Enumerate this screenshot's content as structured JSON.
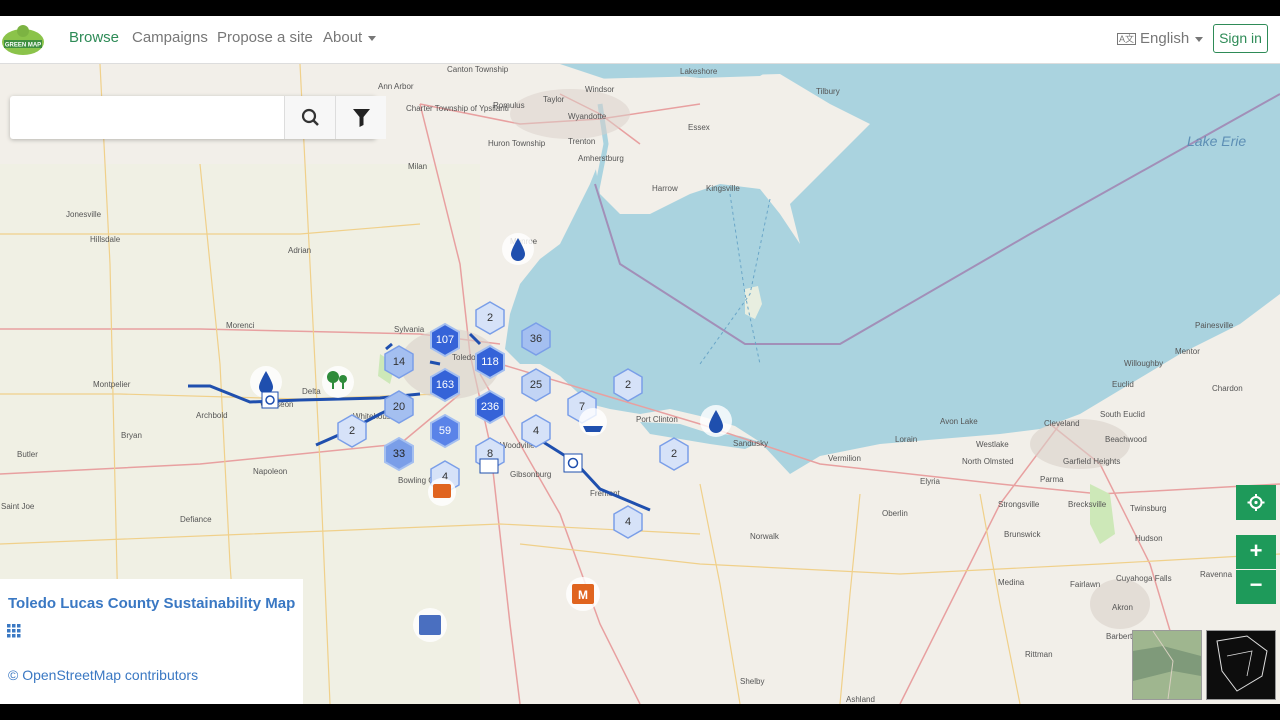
{
  "header": {
    "logo_text": "GREEN MAP",
    "nav": [
      {
        "label": "Browse",
        "active": true
      },
      {
        "label": "Campaigns",
        "active": false
      },
      {
        "label": "Propose a site",
        "active": false
      },
      {
        "label": "About",
        "active": false
      }
    ],
    "language": "English",
    "language_icon": "translate-icon",
    "sign_in": "Sign in"
  },
  "search": {
    "value": "",
    "placeholder": "",
    "search_icon": "search-icon",
    "filter_icon": "filter-icon"
  },
  "panel": {
    "map_title": "Toledo Lucas County Sustainability Map",
    "grid_icon": "grid-icon",
    "attribution": "© OpenStreetMap contributors"
  },
  "controls": {
    "locate_icon": "crosshair-icon",
    "zoom_in": "+",
    "zoom_out": "−"
  },
  "map": {
    "water_label": "Lake Erie",
    "places": [
      "Canton Township",
      "Lakeshore",
      "Ann Arbor",
      "Taylor",
      "Charter Township of Ypsilanti",
      "Romulus",
      "Wyandotte",
      "Windsor",
      "Tilbury",
      "Essex",
      "Huron Township",
      "Trenton",
      "Amherstburg",
      "Harrow",
      "Kingsville",
      "Milan",
      "Jonesville",
      "Hillsdale",
      "Adrian",
      "Monroe",
      "Morenci",
      "Sylvania",
      "Toledo",
      "Montpelier",
      "Delta",
      "Wauseon",
      "Archbold",
      "Bryan",
      "Whitehouse",
      "Butler",
      "Napoleon",
      "Defiance",
      "Saint Joe",
      "Bowling Green",
      "Woodville",
      "Gibsonburg",
      "Fremont",
      "Port Clinton",
      "Sandusky",
      "Vermilion",
      "Lorain",
      "Avon Lake",
      "Westlake",
      "North Olmsted",
      "Cleveland",
      "Euclid",
      "Willoughby",
      "Mentor",
      "Painesville",
      "Chardon",
      "South Euclid",
      "Beachwood",
      "Garfield Heights",
      "Parma",
      "Brecksville",
      "Twinsburg",
      "Hudson",
      "Strongsville",
      "Elyria",
      "Oberlin",
      "Norwalk",
      "Brunswick",
      "Medina",
      "Fairlawn",
      "Cuyahoga Falls",
      "Ravenna",
      "Akron",
      "Barberton",
      "Rittman",
      "Shelby",
      "Ashland",
      "Vermilion"
    ],
    "clusters": [
      "107",
      "118",
      "163",
      "236",
      "59",
      "33",
      "20",
      "14",
      "36",
      "25",
      "2",
      "2",
      "2",
      "2",
      "7",
      "4",
      "8",
      "4",
      "4"
    ]
  },
  "colors": {
    "brand_green": "#2e8b57",
    "link_blue": "#3a78c3",
    "water": "#aad3df",
    "land": "#f2efe9",
    "cluster_light": "#a4bff0",
    "cluster_dark": "#3563d8",
    "route": "#1f4fae"
  }
}
